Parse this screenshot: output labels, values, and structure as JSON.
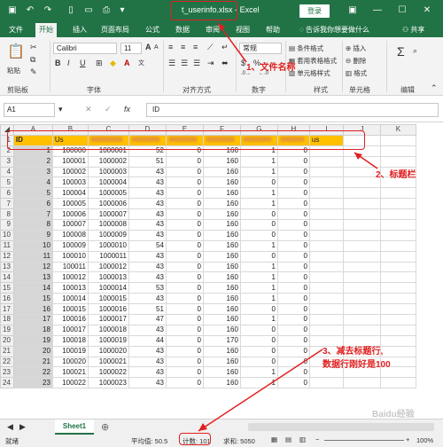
{
  "title": {
    "filename": "t_userinfo.xlsx",
    "app": "Excel",
    "separator": "-",
    "login": "登录"
  },
  "tabs": [
    "文件",
    "开始",
    "插入",
    "页面布局",
    "公式",
    "数据",
    "审阅",
    "视图",
    "帮助"
  ],
  "tell_me": "告诉我你想要做什么",
  "share": "共享",
  "ribbon": {
    "paste": "粘贴",
    "clipboard": "剪贴板",
    "font_name": "Calibri",
    "font_size": "11",
    "font_group": "字体",
    "align_group": "对齐方式",
    "number_format": "常规",
    "number_group": "数字",
    "cond_format": "条件格式",
    "table_format": "套用表格格式",
    "cell_style": "单元格样式",
    "styles_group": "样式",
    "insert": "插入",
    "delete": "删除",
    "format": "格式",
    "cells_group": "单元格",
    "edit_group": "编辑",
    "font_btns": [
      "B",
      "I",
      "U"
    ]
  },
  "formula_bar": {
    "name_box": "A1",
    "formula": "ID",
    "fx": "fx"
  },
  "grid": {
    "columns": [
      "A",
      "B",
      "C",
      "D",
      "E",
      "F",
      "G",
      "H",
      "I",
      "J",
      "K"
    ],
    "header_row": [
      "ID",
      "Us",
      "",
      "",
      "",
      "",
      "",
      "",
      "us",
      "",
      ""
    ],
    "rows": [
      [
        "1",
        "100000",
        "1000001",
        "52",
        "0",
        "160",
        "1",
        "0"
      ],
      [
        "2",
        "100001",
        "1000002",
        "51",
        "0",
        "160",
        "1",
        "0"
      ],
      [
        "3",
        "100002",
        "1000003",
        "43",
        "0",
        "160",
        "1",
        "0"
      ],
      [
        "4",
        "100003",
        "1000004",
        "43",
        "0",
        "160",
        "0",
        "0"
      ],
      [
        "5",
        "100004",
        "1000005",
        "43",
        "0",
        "160",
        "1",
        "0"
      ],
      [
        "6",
        "100005",
        "1000006",
        "43",
        "0",
        "160",
        "1",
        "0"
      ],
      [
        "7",
        "100006",
        "1000007",
        "43",
        "0",
        "160",
        "0",
        "0"
      ],
      [
        "8",
        "100007",
        "1000008",
        "43",
        "0",
        "160",
        "0",
        "0"
      ],
      [
        "9",
        "100008",
        "1000009",
        "43",
        "0",
        "160",
        "0",
        "0"
      ],
      [
        "10",
        "100009",
        "1000010",
        "54",
        "0",
        "160",
        "1",
        "0"
      ],
      [
        "11",
        "100010",
        "1000011",
        "43",
        "0",
        "160",
        "0",
        "0"
      ],
      [
        "12",
        "100011",
        "1000012",
        "43",
        "0",
        "160",
        "1",
        "0"
      ],
      [
        "13",
        "100012",
        "1000013",
        "43",
        "0",
        "160",
        "1",
        "0"
      ],
      [
        "14",
        "100013",
        "1000014",
        "53",
        "0",
        "160",
        "1",
        "0"
      ],
      [
        "15",
        "100014",
        "1000015",
        "43",
        "0",
        "160",
        "1",
        "0"
      ],
      [
        "16",
        "100015",
        "1000016",
        "51",
        "0",
        "160",
        "0",
        "0"
      ],
      [
        "17",
        "100016",
        "1000017",
        "47",
        "0",
        "160",
        "1",
        "0"
      ],
      [
        "18",
        "100017",
        "1000018",
        "43",
        "0",
        "160",
        "0",
        "0"
      ],
      [
        "19",
        "100018",
        "1000019",
        "44",
        "0",
        "170",
        "0",
        "0"
      ],
      [
        "20",
        "100019",
        "1000020",
        "43",
        "0",
        "160",
        "0",
        "0"
      ],
      [
        "21",
        "100020",
        "1000021",
        "43",
        "0",
        "160",
        "0",
        "0"
      ],
      [
        "22",
        "100021",
        "1000022",
        "43",
        "0",
        "160",
        "1",
        "0"
      ],
      [
        "23",
        "100022",
        "1000023",
        "43",
        "0",
        "160",
        "1",
        "0"
      ]
    ]
  },
  "sheet_tab": "Sheet1",
  "status": {
    "ready": "就绪",
    "average": "平均值: 50.5",
    "count": "计数: 101",
    "sum": "求和: 5050",
    "zoom": "100%"
  },
  "annotations": {
    "a1": "1、文件名称",
    "a2": "2、标题栏",
    "a3_line1": "3、减去标题行,",
    "a3_line2": "数据行刚好是100",
    "watermark": "Baidu经验"
  },
  "colors": {
    "excel_green": "#217346",
    "header_fill": "#ffc000",
    "annotation_red": "#e02020"
  }
}
